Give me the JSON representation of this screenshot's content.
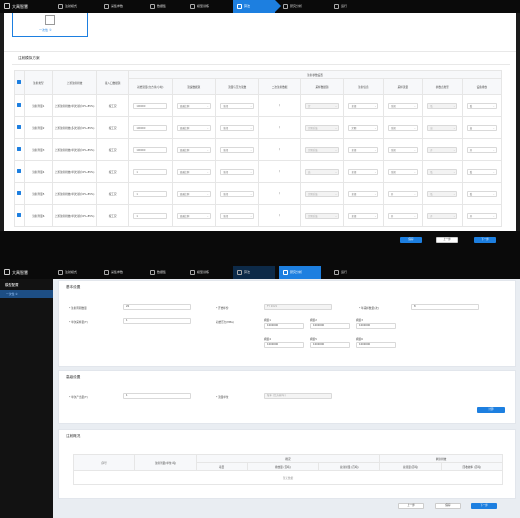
{
  "app": {
    "title": "大禹智慧"
  },
  "steps": [
    "注射模式",
    "采集参数",
    "数据集",
    "模型训练",
    "算法",
    "研究分析",
    "运行"
  ],
  "top_panel": {
    "design_card_label": "一次性 ①",
    "section_title": "注射模拟方案",
    "header_group": "注射参数设置",
    "columns": [
      "注射类型",
      "上游注射排放",
      "接入口数据源",
      "初始流量(立方米/小时)",
      "流速数据源",
      "流量与压力读数",
      "二次注射数据",
      "采样数据源",
      "注射信息",
      "采样流量",
      "参数点类型",
      "设备排放"
    ],
    "rows": [
      {
        "name": "注射剂量1",
        "method": "上游注射排放(单次注射:0%-85%)",
        "source": "按工况",
        "init": "100000",
        "speed": "流速比例",
        "press": "全闭",
        "second": "/",
        "samp": "定",
        "info": "全闭",
        "rate": "全闭",
        "type": "低"
      },
      {
        "name": "注射剂量2",
        "method": "上游注射排放(多次注射:0%-85%)",
        "source": "按工况",
        "init": "100000",
        "speed": "流速比例",
        "press": "全闭",
        "second": "/",
        "samp": "定期采集",
        "info": "定期",
        "rate": "全闭",
        "type": "高"
      },
      {
        "name": "注射剂量3",
        "method": "上游注射排放(单次注射:0%-85%)",
        "source": "按工况",
        "init": "100000",
        "speed": "流速比例",
        "press": "全闭",
        "second": "/",
        "samp": "定期采集",
        "info": "全闭",
        "rate": "全闭",
        "type": "开"
      },
      {
        "name": "注射剂量4",
        "method": "上游注射排放(单次注射:0%-85%)",
        "source": "按工况",
        "init": "1",
        "speed": "流速比例",
        "press": "全闭",
        "second": "/",
        "samp": "高",
        "info": "全闭",
        "rate": "全闭",
        "type": "低"
      },
      {
        "name": "注射剂量5",
        "method": "上游注射排放(单次注射:0%-85%)",
        "source": "按工况",
        "init": "1",
        "speed": "流速比例",
        "press": "全闭",
        "second": "/",
        "samp": "定期采集",
        "info": "全闭",
        "rate": "开",
        "type": "低"
      },
      {
        "name": "注射剂量6",
        "method": "上游注射排放(单次注射:0%-85%)",
        "source": "按工况",
        "init": "1",
        "speed": "流速比例",
        "press": "全闭",
        "second": "/",
        "samp": "定期采集",
        "info": "全闭",
        "rate": "开",
        "type": "开"
      }
    ],
    "btn_save": "保存",
    "btn_prev": "上一步",
    "btn_next": "下一步"
  },
  "bottom": {
    "sidebar_title": "模型配置",
    "sidebar_item": "一次性 ①",
    "basic_title": "基本设置",
    "f1_label": "* 注射周期数量",
    "f1_val": "20",
    "f2_label": "* 开始年份",
    "f2_val": "FY 2021",
    "f3_label": "* 年采样数量(次)",
    "f3_val": "8",
    "f4_label": "* 单次采样量(T)",
    "f4_val": "1",
    "pressure_label": "初始压力(MPa)",
    "p_labels": [
      "阀组1",
      "阀组2",
      "阀组3",
      "阀组4",
      "阀组5",
      "阀组6"
    ],
    "p_vals": [
      "1000000",
      "1000000",
      "1000000",
      "1000000",
      "1000000",
      "1000000"
    ],
    "advanced_title": "高级设置",
    "f5_label": "* 单次产出量(T)",
    "f5_val": "1",
    "f6_label": "* 流量单位",
    "f6_val": "每年 (立方米/年)",
    "btn_calc": "计算",
    "result_title": "注射概况",
    "result_cols": [
      "序号",
      "注射剂量(单位:吨)",
      "概况",
      "",
      "",
      "剩余排放"
    ],
    "result_sub": [
      "项目",
      "排放量 (百吨)",
      "总注射量 (百吨)",
      "总流量(百吨)",
      "回收效率 (百吨)"
    ],
    "empty": "暂无数据",
    "btn_prev": "上一步",
    "btn_next": "下一步",
    "btn_save": "保存"
  }
}
